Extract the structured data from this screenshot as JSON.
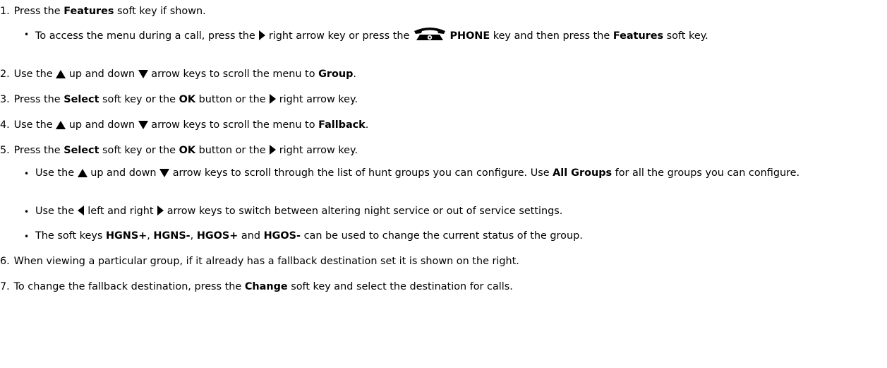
{
  "steps": [
    {
      "num": "1.",
      "a": "Press the ",
      "b1": "Features",
      "c": " soft key if shown."
    },
    {
      "num": "2.",
      "a": "Use the ",
      "b": " up and down ",
      "c": " arrow keys to scroll the menu to ",
      "b1": "Group",
      "d": "."
    },
    {
      "num": "3.",
      "a": "Press the ",
      "b1": "Select",
      "c": " soft key or the ",
      "b2": "OK",
      "d": " button or the ",
      "e": " right arrow key."
    },
    {
      "num": "4.",
      "a": "Use the ",
      "b": " up and down ",
      "c": " arrow keys to scroll the menu to ",
      "b1": "Fallback",
      "d": "."
    },
    {
      "num": "5.",
      "a": "Press the ",
      "b1": "Select",
      "c": " soft key or the ",
      "b2": "OK",
      "d": " button or the ",
      "e": " right arrow key."
    },
    {
      "num": "6.",
      "a": "When viewing a particular group, if it already has a fallback destination set it is shown on the right."
    },
    {
      "num": "7.",
      "a": "To change the fallback destination, press the ",
      "b1": "Change",
      "c": " soft key and select the destination for calls."
    }
  ],
  "step1_bullet": {
    "a": "To access the menu during a call, press the ",
    "b": " right arrow key or press the ",
    "b1": "PHONE",
    "c": " key and then press the ",
    "b2": "Features",
    "d": " soft key."
  },
  "step5_bullets": {
    "one": {
      "a": "Use the ",
      "b": " up and down ",
      "c": " arrow keys to scroll through the list of hunt groups you can configure. Use ",
      "b1": "All Groups",
      "d": " for all the groups you can configure."
    },
    "two": {
      "a": "Use the ",
      "b": " left and right ",
      "c": " arrow keys to switch between altering night service or out of service settings."
    },
    "three": {
      "a": "The soft keys ",
      "b1": "HGNS+",
      "s1": ", ",
      "b2": "HGNS-",
      "s2": ", ",
      "b3": "HGOS+",
      "s3": " and ",
      "b4": "HGOS-",
      "c": " can be used to change the current status of the group."
    }
  },
  "icons": [
    "right-arrow-icon",
    "phone-icon",
    "up-arrow-icon",
    "down-arrow-icon",
    "left-arrow-icon"
  ]
}
